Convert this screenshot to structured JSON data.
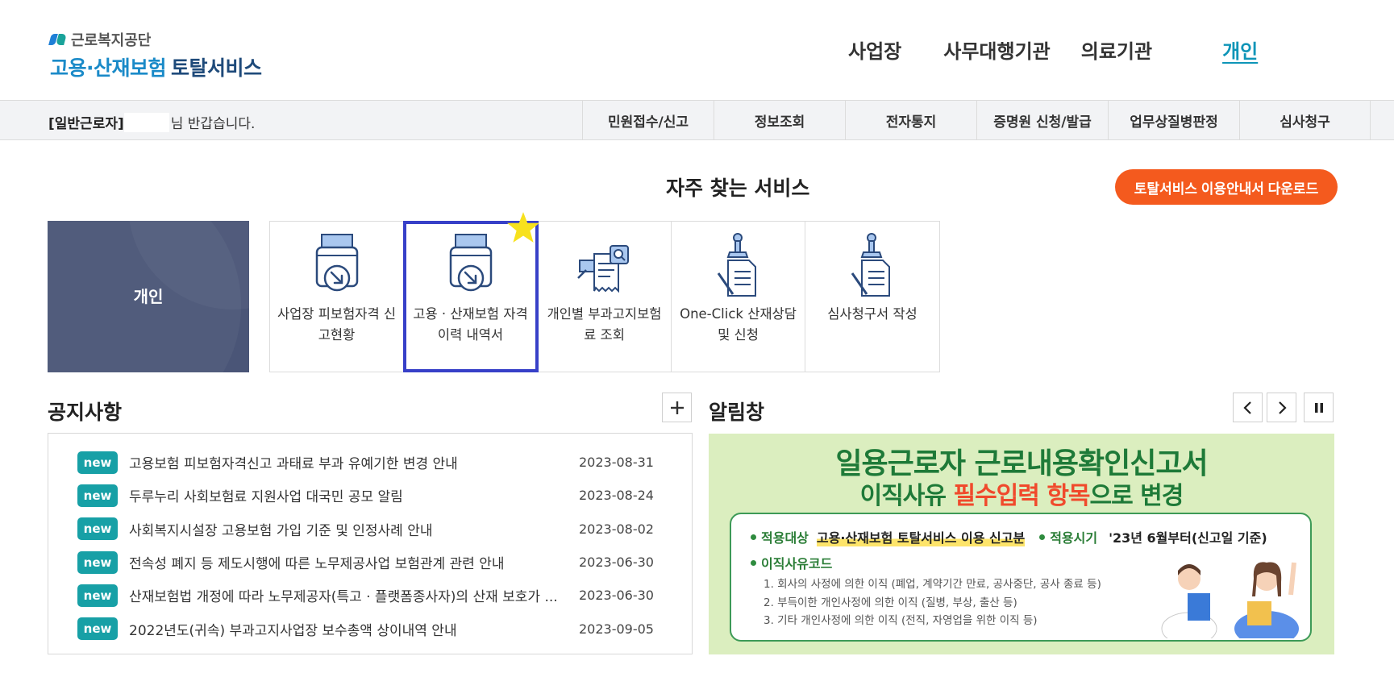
{
  "header": {
    "logo_org": "근로복지공단",
    "logo_service_a": "고용·산재보험",
    "logo_service_b": "토탈서비스",
    "nav": [
      {
        "label": "사업장",
        "active": false
      },
      {
        "label": "사무대행기관",
        "active": false
      },
      {
        "label": "의료기관",
        "active": false
      },
      {
        "label": "개인",
        "active": true
      }
    ]
  },
  "subbar": {
    "user_type": "[일반근로자]",
    "greeting": "님 반갑습니다.",
    "menu": [
      "민원접수/신고",
      "정보조회",
      "전자통지",
      "증명원 신청/발급",
      "업무상질병판정",
      "심사청구"
    ]
  },
  "frequent": {
    "title": "자주 찾는 서비스",
    "download_label": "토탈서비스 이용안내서 다운로드",
    "user_tile": "개인",
    "services": [
      {
        "label": "사업장 피보험자격 신고현황",
        "icon": "document-printer-icon"
      },
      {
        "label": "고용 · 산재보험 자격 이력 내역서",
        "icon": "document-printer-icon",
        "selected": true,
        "favorite_icon": "star-icon"
      },
      {
        "label": "개인별 부과고지보험료 조회",
        "icon": "receipt-search-icon"
      },
      {
        "label": "One-Click 산재상담 및 신청",
        "icon": "stamp-document-icon"
      },
      {
        "label": "심사청구서 작성",
        "icon": "stamp-document-icon"
      }
    ]
  },
  "notice": {
    "title": "공지사항",
    "more_icon": "plus-icon",
    "badge": "new",
    "items": [
      {
        "title": "고용보험 피보험자격신고 과태료 부과 유예기한 변경 안내",
        "date": "2023-08-31"
      },
      {
        "title": "두루누리 사회보험료 지원사업 대국민 공모 알림",
        "date": "2023-08-24"
      },
      {
        "title": "사회복지시설장 고용보험 가입 기준 및 인정사례 안내",
        "date": "2023-08-02"
      },
      {
        "title": "전속성 폐지 등 제도시행에 따른 노무제공사업 보험관계 관련 안내",
        "date": "2023-06-30"
      },
      {
        "title": "산재보험법 개정에 따라 노무제공자(특고 · 플랫폼종사자)의 산재 보호가 ...",
        "date": "2023-06-30"
      },
      {
        "title": "2022년도(귀속) 부과고지사업장 보수총액 상이내역 안내",
        "date": "2023-09-05"
      }
    ]
  },
  "alert": {
    "title": "알림창",
    "controls": [
      "prev-icon",
      "next-icon",
      "pause-icon"
    ],
    "banner": {
      "line1": "일용근로자 근로내용확인신고서",
      "line2_a": "이직사유 ",
      "line2_hl": "필수입력 항목",
      "line2_b": "으로 변경",
      "target_label": "적용대상",
      "target_value": "고용·산재보험 토탈서비스 이용 신고분",
      "period_label": "적용시기",
      "period_value": "'23년 6월부터(신고일 기준)",
      "code_label": "이직사유코드",
      "codes": [
        "1. 회사의 사정에 의한 이직 (폐업, 계약기간 만료, 공사중단, 공사 종료 등)",
        "2. 부득이한 개인사정에 의한 이직 (질병, 부상, 출산 등)",
        "3. 기타 개인사정에 의한 이직 (전직, 자영업을 위한 이직 등)"
      ]
    }
  },
  "colors": {
    "accent": "#0e95b8",
    "download": "#f45a1e",
    "badge": "#17a0a6",
    "user_tile": "#4a5577",
    "selected_border": "#3740c8",
    "banner_bg": "#dbeebf"
  }
}
